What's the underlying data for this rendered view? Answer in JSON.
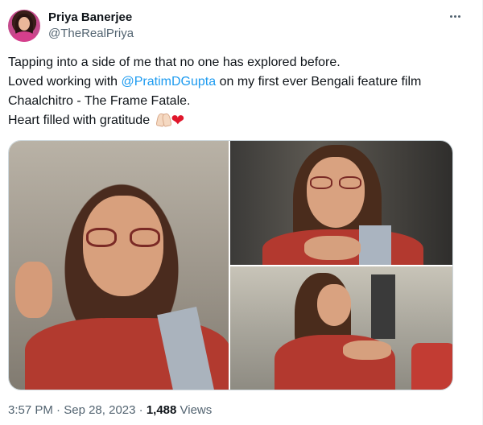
{
  "author": {
    "display_name": "Priya Banerjee",
    "handle": "@TheRealPriya"
  },
  "more_icon": "more-horizontal-icon",
  "tweet": {
    "line1": "Tapping into a side of me that no one has explored before.",
    "line2_prefix": "Loved working with ",
    "mention": "@PratimDGupta",
    "line2_suffix": " on my first ever Bengali feature film",
    "line3": "Chaalchitro - The Frame Fatale.",
    "line4": "Heart filled with gratitude ",
    "emoji_pray": "folded-hands-emoji",
    "emoji_heart": "❤"
  },
  "media": {
    "count": 3
  },
  "meta": {
    "time": "3:57 PM",
    "separator": " · ",
    "date": "Sep 28, 2023",
    "separator2": " · ",
    "views_count": "1,488",
    "views_label": " Views"
  },
  "colors": {
    "link": "#1d9bf0",
    "text": "#0f1419",
    "secondary": "#536471",
    "heart": "#e0162b"
  }
}
